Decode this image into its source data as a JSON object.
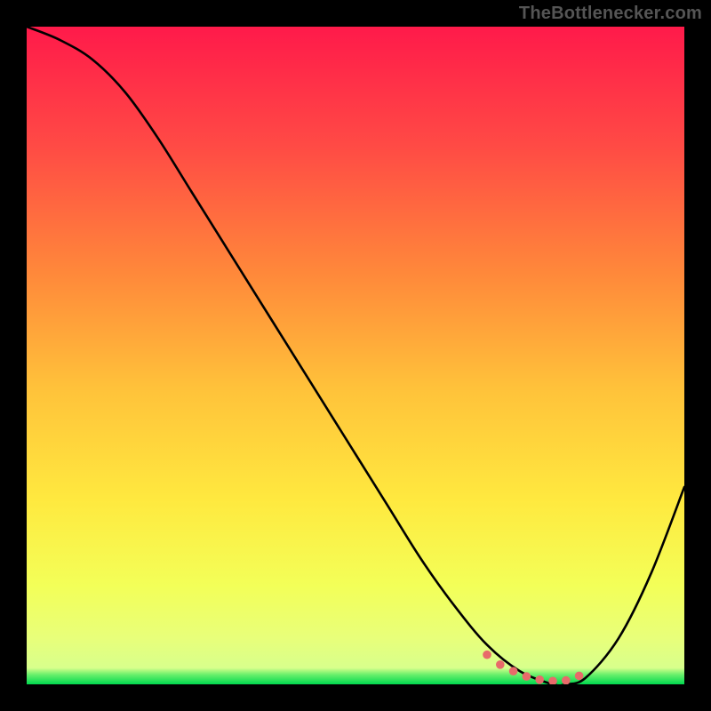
{
  "watermark": "TheBottlenecker.com",
  "colors": {
    "gradient_top": "#ff1a4a",
    "gradient_mid1": "#ff6b3d",
    "gradient_mid2": "#ffd23f",
    "gradient_mid3": "#f7ff3f",
    "gradient_bottom_yellow": "#ecff66",
    "gradient_green": "#00e05a",
    "curve": "#000000",
    "dots": "#e86a6a",
    "frame": "#000000"
  },
  "chart_data": {
    "type": "line",
    "title": "",
    "xlabel": "",
    "ylabel": "",
    "xlim": [
      0,
      100
    ],
    "ylim": [
      0,
      100
    ],
    "series": [
      {
        "name": "bottleneck-curve",
        "x": [
          0,
          5,
          10,
          15,
          20,
          25,
          30,
          35,
          40,
          45,
          50,
          55,
          60,
          65,
          70,
          75,
          80,
          82,
          85,
          90,
          95,
          100
        ],
        "y": [
          100,
          98,
          95,
          90,
          83,
          75,
          67,
          59,
          51,
          43,
          35,
          27,
          19,
          12,
          6,
          2,
          0,
          0,
          1,
          7,
          17,
          30
        ]
      }
    ],
    "highlight_points": {
      "name": "optimal-range-dots",
      "x": [
        70,
        72,
        74,
        76,
        78,
        80,
        82,
        84
      ],
      "y": [
        4.5,
        3.0,
        2.0,
        1.2,
        0.7,
        0.5,
        0.6,
        1.3
      ]
    }
  }
}
